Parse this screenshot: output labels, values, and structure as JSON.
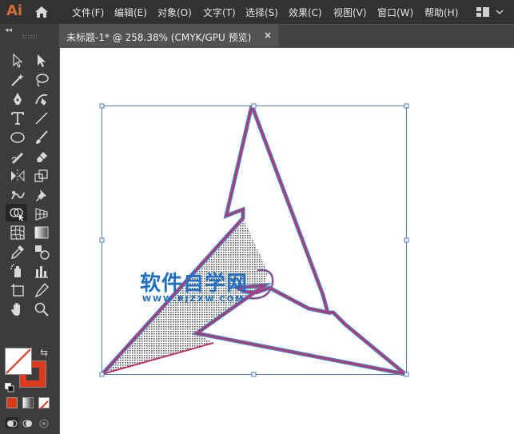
{
  "app": {
    "logo": "Ai",
    "accent_color": "#d36c35"
  },
  "menubar": {
    "items": [
      {
        "label": "文件(F)"
      },
      {
        "label": "编辑(E)"
      },
      {
        "label": "对象(O)"
      },
      {
        "label": "文字(T)"
      },
      {
        "label": "选择(S)"
      },
      {
        "label": "效果(C)"
      },
      {
        "label": "视图(V)"
      },
      {
        "label": "窗口(W)"
      },
      {
        "label": "帮助(H)"
      }
    ],
    "home_icon": "home-icon",
    "workspace_icon": "workspace-switcher-icon"
  },
  "toolbar": {
    "collapse_label": "◂◂",
    "fill_color": "#ffffff",
    "stroke_color": "#e03a1e",
    "active_tool": "shape-builder-tool"
  },
  "document": {
    "tab_label": "未标题-1* @ 258.38% (CMYK/GPU 预览)",
    "close_label": "×"
  },
  "canvas": {
    "watermark_title": "软件自学网",
    "watermark_url": "WWW.RJZXW.COM",
    "selection_color": "#4a7fc1",
    "path_color": "#c0306a"
  }
}
